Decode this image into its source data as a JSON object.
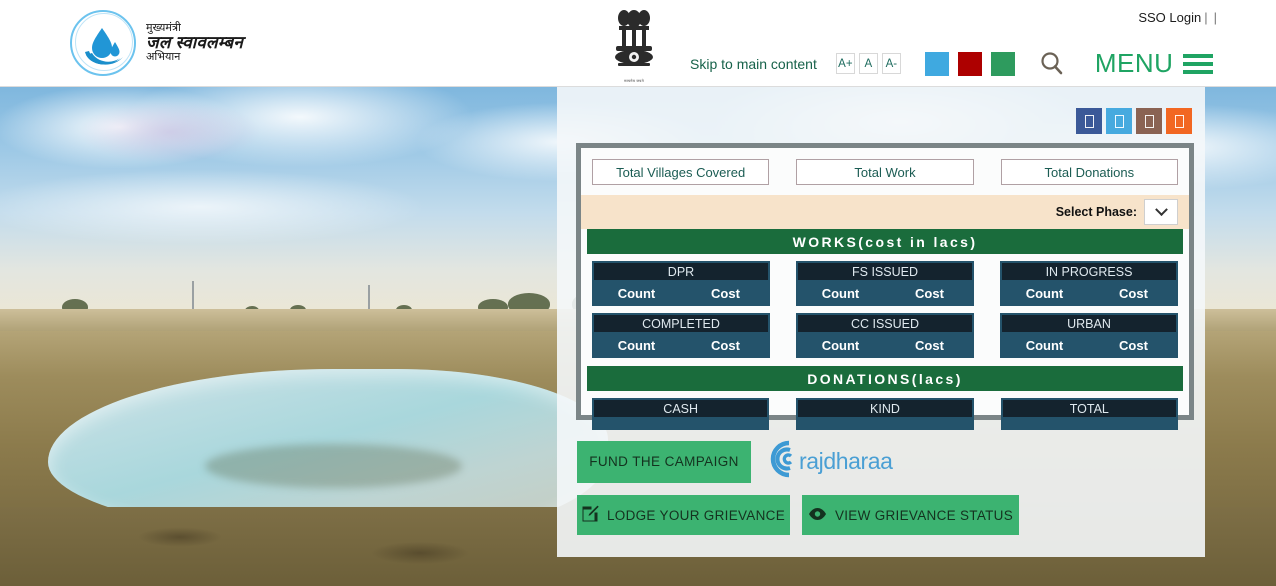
{
  "header": {
    "logo": {
      "line1": "मुख्यमंत्री",
      "line2": "जल स्वावलम्बन",
      "line3": "अभियान"
    },
    "emblem_caption": "सत्यमेव जयते",
    "sso_label": "SSO Login",
    "sso_sep": "|",
    "skip_label": "Skip to main content",
    "font_sizes": [
      "A+",
      "A",
      "A-"
    ],
    "theme_swatches": [
      "#3fa9e0",
      "#ad0000",
      "#2e9b5e"
    ],
    "menu_label": "MENU"
  },
  "color_buttons": [
    {
      "name": "theme-navy",
      "color": "#3b5998"
    },
    {
      "name": "theme-lightblue",
      "color": "#46aadf"
    },
    {
      "name": "theme-brown",
      "color": "#8a6353"
    },
    {
      "name": "theme-orange",
      "color": "#f26722"
    }
  ],
  "dashboard": {
    "totals": [
      "Total Villages Covered",
      "Total Work",
      "Total Donations"
    ],
    "phase_label": "Select Phase:",
    "phase_value": "",
    "works_heading": "WORKS(cost in lacs)",
    "count_label": "Count",
    "cost_label": "Cost",
    "works": [
      {
        "title": "DPR",
        "count": "",
        "cost": ""
      },
      {
        "title": "FS ISSUED",
        "count": "",
        "cost": ""
      },
      {
        "title": "IN PROGRESS",
        "count": "",
        "cost": ""
      },
      {
        "title": "COMPLETED",
        "count": "",
        "cost": ""
      },
      {
        "title": "CC ISSUED",
        "count": "",
        "cost": ""
      },
      {
        "title": "URBAN",
        "count": "",
        "cost": ""
      }
    ],
    "donations_heading": "DONATIONS(lacs)",
    "donations": [
      {
        "title": "CASH",
        "value": ""
      },
      {
        "title": "KIND",
        "value": ""
      },
      {
        "title": "TOTAL",
        "value": ""
      }
    ]
  },
  "actions": {
    "fund_label": "FUND THE CAMPAIGN",
    "rajdharaa_label": "rajdharaa",
    "lodge_label": "LODGE YOUR GRIEVANCE",
    "view_label": "VIEW GRIEVANCE STATUS"
  }
}
